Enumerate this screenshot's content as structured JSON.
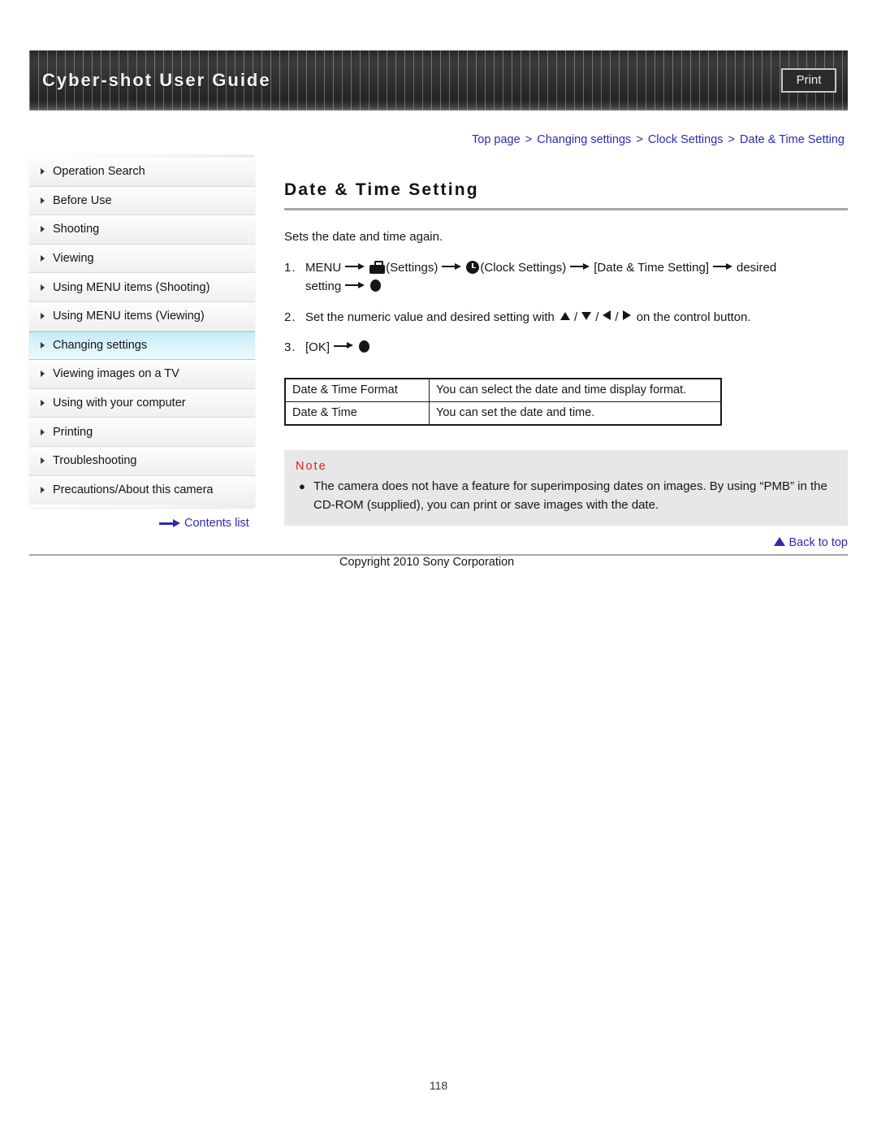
{
  "header": {
    "title": "Cyber-shot User Guide",
    "print_label": "Print"
  },
  "breadcrumb": {
    "separator": ">",
    "items": [
      "Top page",
      "Changing settings",
      "Clock Settings",
      "Date & Time Setting"
    ]
  },
  "sidebar": {
    "items": [
      {
        "label": "Operation Search",
        "active": false
      },
      {
        "label": "Before Use",
        "active": false
      },
      {
        "label": "Shooting",
        "active": false
      },
      {
        "label": "Viewing",
        "active": false
      },
      {
        "label": "Using MENU items (Shooting)",
        "active": false
      },
      {
        "label": "Using MENU items (Viewing)",
        "active": false
      },
      {
        "label": "Changing settings",
        "active": true
      },
      {
        "label": "Viewing images on a TV",
        "active": false
      },
      {
        "label": "Using with your computer",
        "active": false
      },
      {
        "label": "Printing",
        "active": false
      },
      {
        "label": "Troubleshooting",
        "active": false
      },
      {
        "label": "Precautions/About this camera",
        "active": false
      }
    ],
    "contents_list_label": "Contents list"
  },
  "main": {
    "title": "Date & Time Setting",
    "intro": "Sets the date and time again.",
    "steps": {
      "step1": {
        "num": "1.",
        "menu": "MENU",
        "settings_label": "(Settings)",
        "clock_label": "(Clock Settings)",
        "bracket_item": "[Date & Time Setting]",
        "desired": "desired",
        "setting": "setting"
      },
      "step2": {
        "num": "2.",
        "text_before": "Set the numeric value and desired setting with",
        "text_after": "on the control button."
      },
      "step3": {
        "num": "3.",
        "ok": "[OK]"
      }
    },
    "table": {
      "rows": [
        {
          "term": "Date & Time Format",
          "desc": "You can select the date and time display format."
        },
        {
          "term": "Date & Time",
          "desc": "You can set the date and time."
        }
      ]
    },
    "note": {
      "heading": "Note",
      "bullet": "●",
      "text": "The camera does not have a feature for superimposing dates on images. By using “PMB” in the CD-ROM (supplied), you can print or save images with the date."
    }
  },
  "footer": {
    "back_to_top": "Back to top",
    "copyright": "Copyright 2010 Sony Corporation",
    "page_number": "118"
  },
  "colors": {
    "link": "#2b2bb5",
    "note_heading": "#e02020",
    "active_nav": "#c4ecf7",
    "header_bg": "#2e2e2e"
  }
}
